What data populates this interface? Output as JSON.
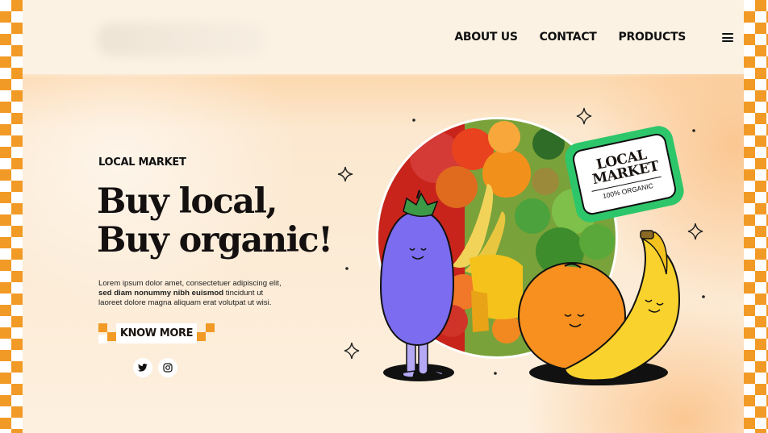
{
  "nav": {
    "items": [
      "ABOUT US",
      "CONTACT",
      "PRODUCTS"
    ],
    "menu_icon": "hamburger-menu-icon"
  },
  "hero": {
    "eyebrow": "LOCAL MARKET",
    "headline_line1": "Buy local,",
    "headline_line2": "Buy organic!",
    "body_plain1": "Lorem ipsum dolor amet, consectetuer adipiscing elit, ",
    "body_bold": "sed diam nonummy nibh euismod",
    "body_plain2": " tincidunt ut laoreet dolore magna aliquam erat volutpat ut wisi.",
    "cta_label": "KNOW MORE"
  },
  "socials": [
    {
      "icon": "twitter-icon"
    },
    {
      "icon": "instagram-icon"
    }
  ],
  "badge": {
    "title": "LOCAL MARKET",
    "subtitle": "100% ORGANIC"
  },
  "colors": {
    "accent_orange": "#f29a26",
    "badge_green": "#2ec66a",
    "eggplant": "#7b6cf0",
    "orange_fruit": "#f7901e",
    "banana": "#f9d22e"
  }
}
